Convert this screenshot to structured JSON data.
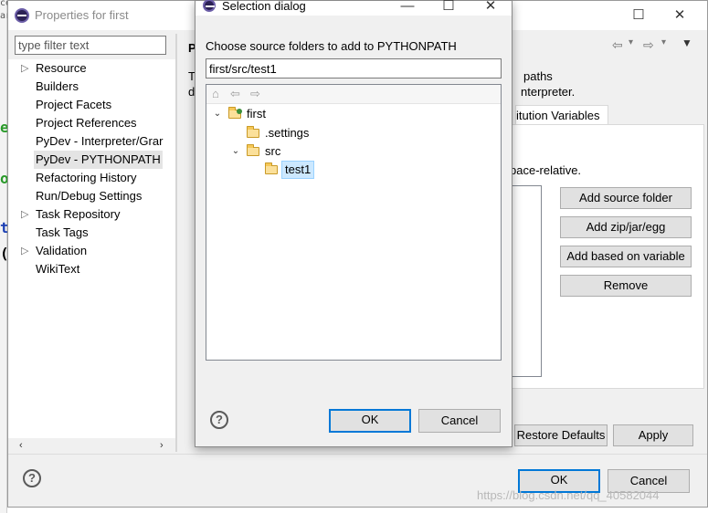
{
  "properties_window": {
    "title": "Properties for first",
    "filter_placeholder": "type filter text",
    "tree_items": [
      {
        "label": "Resource",
        "expandable": true
      },
      {
        "label": "Builders",
        "expandable": false
      },
      {
        "label": "Project Facets",
        "expandable": false
      },
      {
        "label": "Project References",
        "expandable": false
      },
      {
        "label": "PyDev - Interpreter/Grar",
        "expandable": false
      },
      {
        "label": "PyDev - PYTHONPATH",
        "expandable": false,
        "selected": true
      },
      {
        "label": "Refactoring History",
        "expandable": false
      },
      {
        "label": "Run/Debug Settings",
        "expandable": false
      },
      {
        "label": "Task Repository",
        "expandable": true
      },
      {
        "label": "Task Tags",
        "expandable": false
      },
      {
        "label": "Validation",
        "expandable": true
      },
      {
        "label": "WikiText",
        "expandable": false
      }
    ],
    "page_heading_fragment": "P",
    "partial_text": {
      "line1_left": "T",
      "line2_left": "d",
      "line1_right": "paths",
      "line2_right": "nterpreter.",
      "tab_fragment": "itution Variables",
      "workspace_text": "kspace-relative."
    },
    "buttons": {
      "add_source_folder": "Add source folder",
      "add_zip": "Add zip/jar/egg",
      "add_based_on_variable": "Add based on variable",
      "remove": "Remove",
      "restore_defaults": "Restore Defaults",
      "apply": "Apply",
      "ok": "OK",
      "cancel": "Cancel"
    },
    "editor_fragments": [
      "e",
      "o",
      "t",
      "(",
      "ar",
      "ce"
    ]
  },
  "selection_dialog": {
    "title": "Selection dialog",
    "prompt": "Choose source folders to add to PYTHONPATH",
    "path_value": "first/src/test1",
    "tree": [
      {
        "label": "first",
        "level": 0,
        "expanded": true,
        "type": "project"
      },
      {
        "label": ".settings",
        "level": 1,
        "expanded": false,
        "type": "folder"
      },
      {
        "label": "src",
        "level": 1,
        "expanded": true,
        "type": "folder"
      },
      {
        "label": "test1",
        "level": 2,
        "expanded": false,
        "type": "folder",
        "selected": true
      }
    ],
    "ok_label": "OK",
    "cancel_label": "Cancel"
  },
  "watermark": "https://blog.csdn.net/qq_40582044",
  "icons": {
    "help": "?",
    "minimize": "—",
    "maximize": "☐",
    "close": "✕",
    "back": "⇦",
    "forward": "⇨",
    "home": "⌂",
    "dropdown": "▾"
  },
  "colors": {
    "selection": "#cce8ff",
    "default_button_border": "#0078d7",
    "window_bg": "#f0f0f0"
  }
}
